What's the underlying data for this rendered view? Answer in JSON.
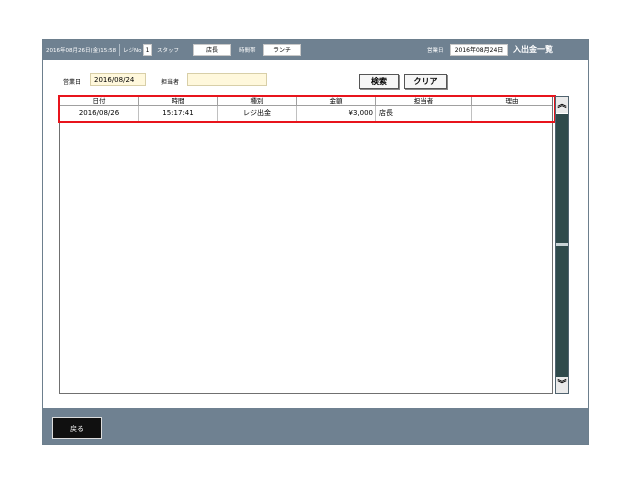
{
  "topbar": {
    "datetime": "2016年08月26日(金)15:58",
    "register_label": "レジNo",
    "register_no": "1",
    "staff_label": "スタッフ",
    "staff_value": "店長",
    "timeslot_label": "時間帯",
    "timeslot_value": "ランチ",
    "business_date_label": "営業日",
    "business_date_value": "2016年08月24日",
    "screen_title": "入出金一覧"
  },
  "filters": {
    "date_label": "営業日",
    "date_value": "2016/08/24",
    "staff_label": "担当者",
    "staff_value": ""
  },
  "buttons": {
    "search": "検索",
    "clear": "クリア",
    "back": "戻る"
  },
  "table": {
    "headers": [
      "日付",
      "時間",
      "種別",
      "金額",
      "担当者",
      "理由"
    ],
    "rows": [
      [
        "2016/08/26",
        "15:17:41",
        "レジ出金",
        "¥3,000",
        "店長",
        ""
      ]
    ]
  },
  "scroll": {
    "up_glyph": "︽",
    "down_glyph": "︾"
  },
  "colors": {
    "bar": "#6f8191",
    "field_bg": "#fff8dc",
    "highlight": "#e8141c",
    "scroll_track": "#2f4a4b"
  }
}
